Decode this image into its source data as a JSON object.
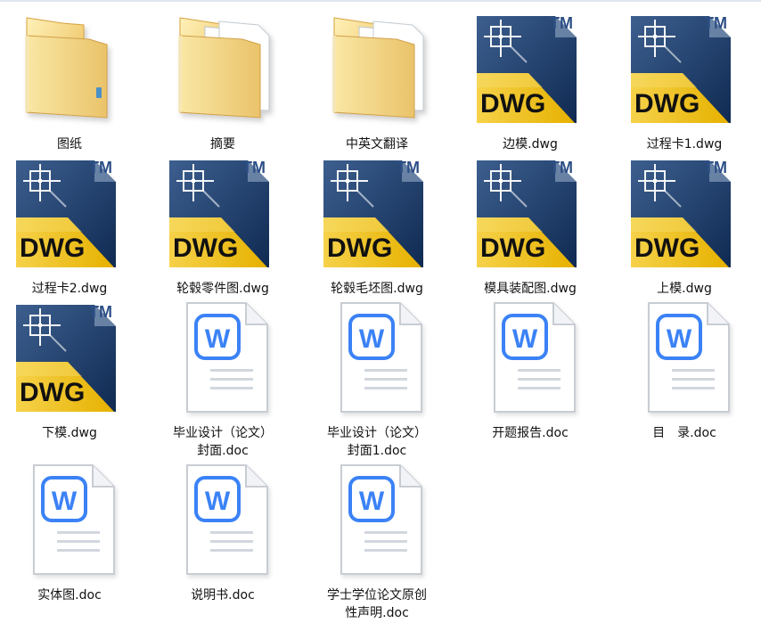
{
  "window": {
    "content_background": "#ffffff"
  },
  "items": [
    {
      "label": "图纸",
      "type": "folder"
    },
    {
      "label": "摘要",
      "type": "folder-docs"
    },
    {
      "label": "中英文翻译",
      "type": "folder-docs"
    },
    {
      "label": "边模.dwg",
      "type": "dwg"
    },
    {
      "label": "过程卡1.dwg",
      "type": "dwg"
    },
    {
      "label": "过程卡2.dwg",
      "type": "dwg"
    },
    {
      "label": "轮毂零件图.dwg",
      "type": "dwg"
    },
    {
      "label": "轮毂毛坯图.dwg",
      "type": "dwg"
    },
    {
      "label": "模具装配图.dwg",
      "type": "dwg"
    },
    {
      "label": "上模.dwg",
      "type": "dwg"
    },
    {
      "label": "下模.dwg",
      "type": "dwg"
    },
    {
      "label": "毕业设计（论文）\n封面.doc",
      "type": "doc"
    },
    {
      "label": "毕业设计（论文）\n封面1.doc",
      "type": "doc"
    },
    {
      "label": "开题报告.doc",
      "type": "doc"
    },
    {
      "label": "目　录.doc",
      "type": "doc"
    },
    {
      "label": "实体图.doc",
      "type": "doc"
    },
    {
      "label": "说明书.doc",
      "type": "doc"
    },
    {
      "label": "学士学位论文原创\n性声明.doc",
      "type": "doc"
    }
  ],
  "icons": {
    "dwg_logo_text": "DWG",
    "dwg_tm_text": "TM",
    "doc_badge_text": "W"
  },
  "colors": {
    "dwg_navy": "#1f3d6b",
    "dwg_yellow": "#f0c20a",
    "doc_blue": "#3b82f6",
    "folder_yellow": "#f3d27a"
  }
}
